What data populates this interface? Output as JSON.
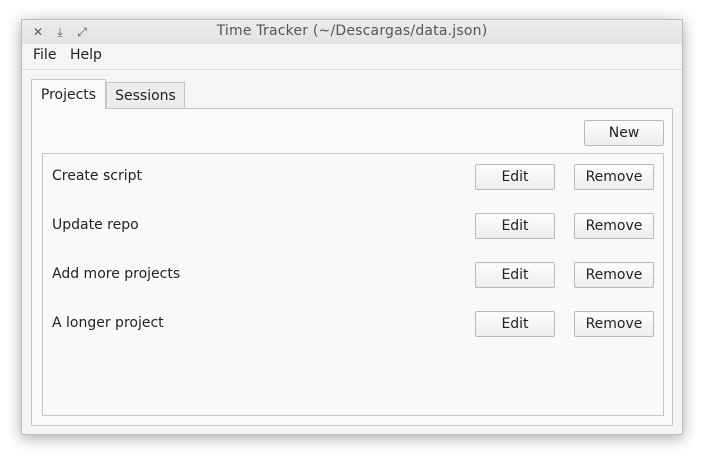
{
  "window": {
    "title": "Time Tracker (~/Descargas/data.json)",
    "controls": [
      {
        "name": "close-icon",
        "glyph": "✕"
      },
      {
        "name": "minimize-icon",
        "glyph": "⤓"
      },
      {
        "name": "maximize-icon",
        "glyph": "⤢"
      }
    ]
  },
  "menubar": {
    "items": [
      "File",
      "Help"
    ]
  },
  "tabs": [
    {
      "label": "Projects",
      "active": true
    },
    {
      "label": "Sessions",
      "active": false
    }
  ],
  "projects": {
    "new_label": "New",
    "edit_label": "Edit",
    "remove_label": "Remove",
    "items": [
      "Create script",
      "Update repo",
      "Add more projects",
      "A longer project"
    ]
  }
}
